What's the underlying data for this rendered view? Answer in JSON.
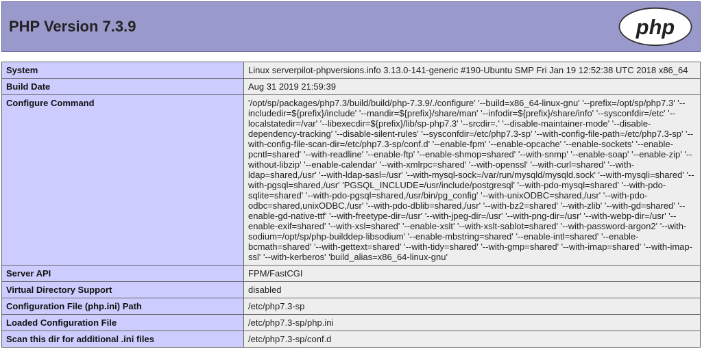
{
  "header": {
    "title": "PHP Version 7.3.9",
    "logo_text": "php"
  },
  "rows": [
    {
      "label": "System",
      "value": "Linux serverpilot-phpversions.info 3.13.0-141-generic #190-Ubuntu SMP Fri Jan 19 12:52:38 UTC 2018 x86_64"
    },
    {
      "label": "Build Date",
      "value": "Aug 31 2019 21:59:39"
    },
    {
      "label": "Configure Command",
      "value": "'/opt/sp/packages/php7.3/build/build/php-7.3.9/./configure' '--build=x86_64-linux-gnu' '--prefix=/opt/sp/php7.3' '--includedir=${prefix}/include' '--mandir=${prefix}/share/man' '--infodir=${prefix}/share/info' '--sysconfdir=/etc' '--localstatedir=/var' '--libexecdir=${prefix}/lib/sp-php7.3' '--srcdir=.' '--disable-maintainer-mode' '--disable-dependency-tracking' '--disable-silent-rules' '--sysconfdir=/etc/php7.3-sp' '--with-config-file-path=/etc/php7.3-sp' '--with-config-file-scan-dir=/etc/php7.3-sp/conf.d' '--enable-fpm' '--enable-opcache' '--enable-sockets' '--enable-pcntl=shared' '--with-readline' '--enable-ftp' '--enable-shmop=shared' '--with-snmp' '--enable-soap' '--enable-zip' '--without-libzip' '--enable-calendar' '--with-xmlrpc=shared' '--with-openssl' '--with-curl=shared' '--with-ldap=shared,/usr' '--with-ldap-sasl=/usr' '--with-mysql-sock=/var/run/mysqld/mysqld.sock' '--with-mysqli=shared' '--with-pgsql=shared,/usr' 'PGSQL_INCLUDE=/usr/include/postgresql' '--with-pdo-mysql=shared' '--with-pdo-sqlite=shared' '--with-pdo-pgsql=shared,/usr/bin/pg_config' '--with-unixODBC=shared,/usr' '--with-pdo-odbc=shared,unixODBC,/usr' '--with-pdo-dblib=shared,/usr' '--with-bz2=shared' '--with-zlib' '--with-gd=shared' '--enable-gd-native-ttf' '--with-freetype-dir=/usr' '--with-jpeg-dir=/usr' '--with-png-dir=/usr' '--with-webp-dir=/usr' '--enable-exif=shared' '--with-xsl=shared' '--enable-xslt' '--with-xslt-sablot=shared' '--with-password-argon2' '--with-sodium=/opt/sp/php-builddep-libsodium' '--enable-mbstring=shared' '--enable-intl=shared' '--enable-bcmath=shared' '--with-gettext=shared' '--with-tidy=shared' '--with-gmp=shared' '--with-imap=shared' '--with-imap-ssl' '--with-kerberos' 'build_alias=x86_64-linux-gnu'"
    },
    {
      "label": "Server API",
      "value": "FPM/FastCGI"
    },
    {
      "label": "Virtual Directory Support",
      "value": "disabled"
    },
    {
      "label": "Configuration File (php.ini) Path",
      "value": "/etc/php7.3-sp"
    },
    {
      "label": "Loaded Configuration File",
      "value": "/etc/php7.3-sp/php.ini"
    },
    {
      "label": "Scan this dir for additional .ini files",
      "value": "/etc/php7.3-sp/conf.d"
    }
  ]
}
